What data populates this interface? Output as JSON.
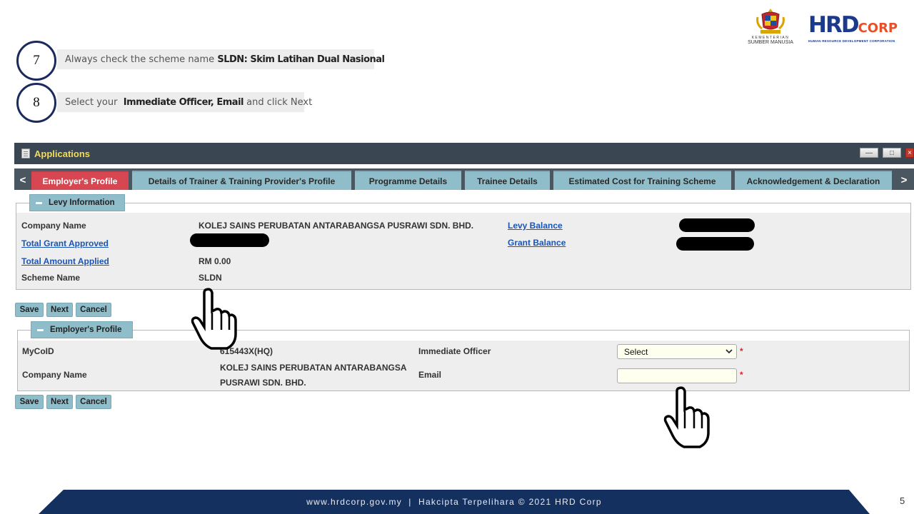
{
  "steps": [
    {
      "number": "7",
      "text_pre": "Always check the scheme name ",
      "text_bold": "SLDN: Skim Latihan Dual Nasional",
      "text_post": ""
    },
    {
      "number": "8",
      "text_pre": "Select your  ",
      "text_bold": "Immediate Officer, Email",
      "text_post": " and click Next"
    }
  ],
  "logos": {
    "ministry_line1": "KEMENTERIAN",
    "ministry_line2": "SUMBER MANUSIA",
    "hrd_mark": "HRD",
    "hrd_suffix": "CORP",
    "hrd_tagline": "HUMAN RESOURCE DEVELOPMENT CORPORATION"
  },
  "app": {
    "title": "Applications",
    "tabs": [
      {
        "label": "Employer's Profile",
        "active": true
      },
      {
        "label": "Details of Trainer & Training Provider's Profile",
        "active": false
      },
      {
        "label": "Programme Details",
        "active": false
      },
      {
        "label": "Trainee Details",
        "active": false
      },
      {
        "label": "Estimated Cost for Training Scheme",
        "active": false
      },
      {
        "label": "Acknowledgement & Declaration",
        "active": false
      }
    ],
    "tab_prev": "<",
    "tab_next": ">"
  },
  "levy": {
    "header": "Levy Information",
    "company_name_label": "Company Name",
    "company_name_value": "KOLEJ SAINS PERUBATAN ANTARABANGSA PUSRAWI SDN. BHD.",
    "total_grant_label": "Total Grant Approved",
    "total_amount_label": "Total Amount Applied",
    "total_amount_value": "RM 0.00",
    "scheme_name_label": "Scheme Name",
    "scheme_name_value": "SLDN",
    "levy_balance_label": "Levy Balance",
    "grant_balance_label": "Grant Balance"
  },
  "actions": {
    "save": "Save",
    "next": "Next",
    "cancel": "Cancel"
  },
  "employer": {
    "header": "Employer's Profile",
    "mycoid_label": "MyCoID",
    "mycoid_value": "615443X(HQ)",
    "company_name_label": "Company Name",
    "company_name_line1": "KOLEJ SAINS PERUBATAN ANTARABANGSA",
    "company_name_line2": "PUSRAWI SDN. BHD.",
    "officer_label": "Immediate Officer",
    "officer_selected": "Select",
    "email_label": "Email",
    "email_value": "",
    "required_mark": "*"
  },
  "footer": {
    "text": "www.hrdcorp.gov.my  |  Hakcipta Terpelihara © 2021 HRD Corp",
    "page_number": "5"
  },
  "colors": {
    "tab_active": "#d64751",
    "tab": "#8fbdca",
    "titlebar": "#3a4652",
    "title_text": "#f5dc57",
    "footer_band": "#14305f",
    "link": "#1a55b5"
  }
}
